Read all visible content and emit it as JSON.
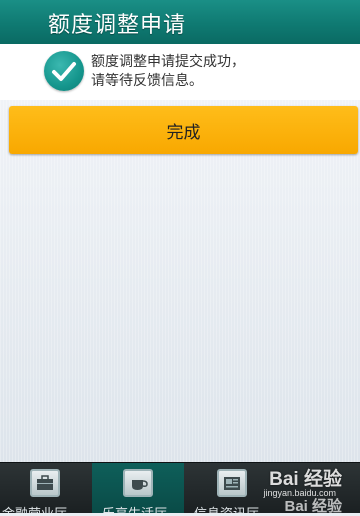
{
  "header": {
    "title": "额度调整申请"
  },
  "notice": {
    "icon": "checkmark-circle-icon",
    "line1": "额度调整申请提交成功，",
    "line2": "请等待反馈信息。"
  },
  "actions": {
    "done_label": "完成"
  },
  "tabbar": {
    "items": [
      {
        "label": "金融营业厅",
        "icon": "briefcase-icon"
      },
      {
        "label": "乐享生活厅",
        "icon": "coffee-cup-icon"
      },
      {
        "label": "信息资讯厅",
        "icon": "newspaper-icon"
      }
    ]
  },
  "watermark": {
    "logo": "Bai 经验",
    "url": "jingyan.baidu.com",
    "logo2": "Bai 经验"
  },
  "colors": {
    "header": "#0f7a72",
    "button": "#f8a800",
    "tabbar": "#1f2527"
  }
}
